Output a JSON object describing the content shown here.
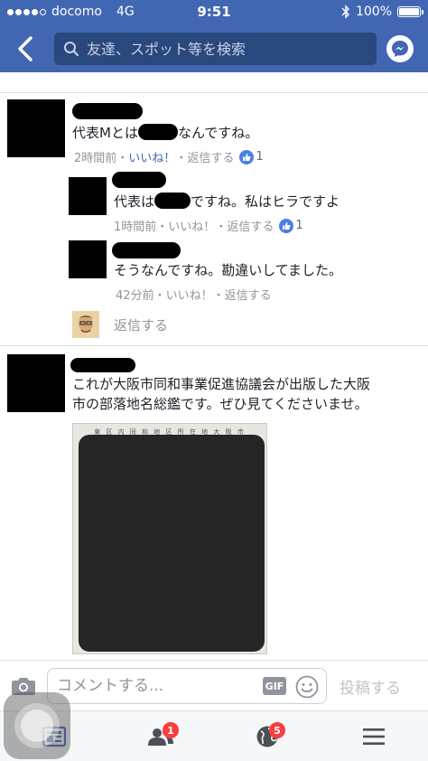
{
  "status_bar": {
    "carrier": "docomo",
    "network": "4G",
    "time": "9:51",
    "battery": "100%",
    "signal_bars_filled": 4,
    "signal_bars_total": 5
  },
  "nav": {
    "search_placeholder": "友達、スポット等を検索"
  },
  "comments": [
    {
      "text_before": "代表Mとは",
      "text_after": "なんですね。",
      "time": "2時間前",
      "like_label": "いいね！",
      "reply_label": "返信する",
      "likes": "1",
      "liked_by_me": true
    },
    {
      "text_before": "代表は",
      "text_after": "ですね。私はヒラですよ",
      "time": "1時間前",
      "like_label": "いいね！",
      "reply_label": "返信する",
      "likes": "1",
      "liked_by_me": false
    },
    {
      "text": "そうなんですね。勘違いしてました。",
      "time": "42分前",
      "like_label": "いいね！",
      "reply_label": "返信する"
    }
  ],
  "reply_prompt": "返信する",
  "post_comment": {
    "line1": "これが大阪市同和事業促進協議会が出版した大阪",
    "line2": "市の部落地名総鑑です。ぜひ見てくださいませ。",
    "image_header": "東 区 内 同 和 地 区 所 在 地 大 阪 市"
  },
  "composer": {
    "placeholder": "コメントする...",
    "gif_label": "GIF",
    "post_label": "投稿する"
  },
  "tabs": {
    "friends_badge": "1",
    "notifications_badge": "5"
  },
  "colors": {
    "brand": "#4267b2",
    "link": "#4267b2",
    "meta": "#90949c",
    "badge": "#fa3e3e"
  }
}
